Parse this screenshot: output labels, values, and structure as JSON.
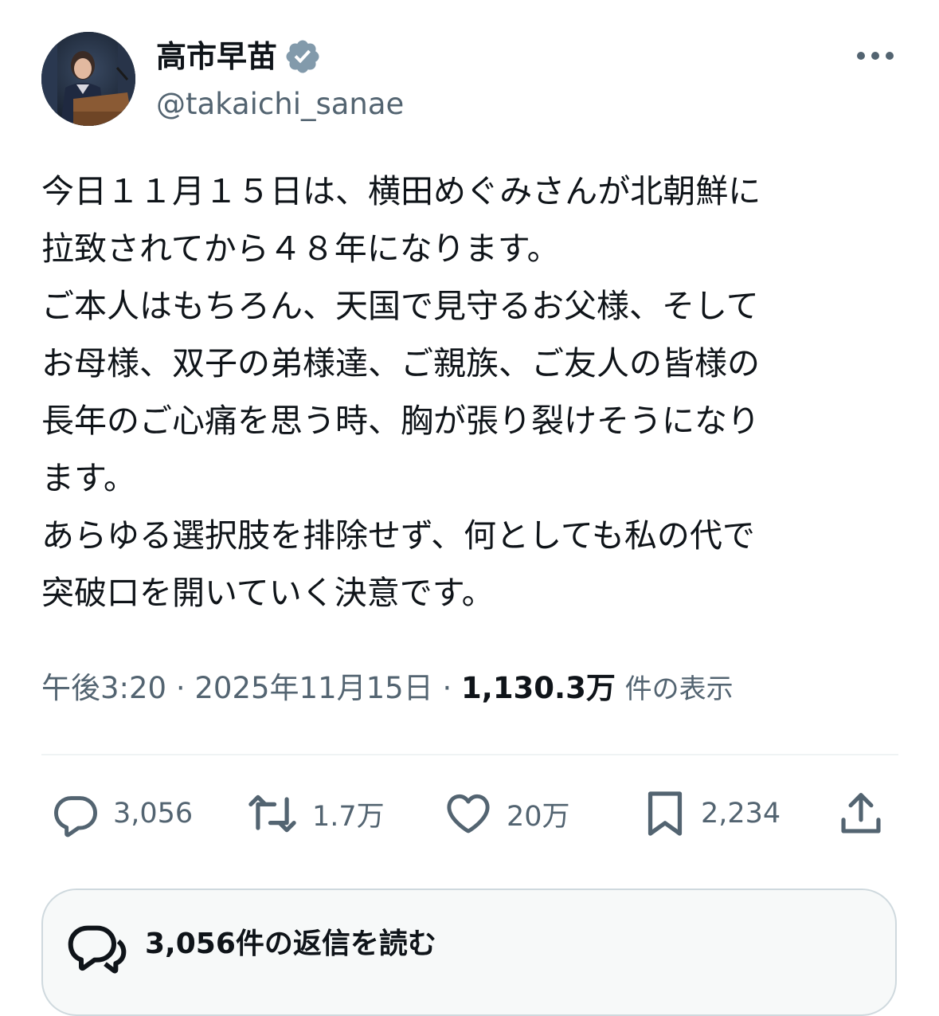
{
  "author": {
    "display_name": "高市早苗",
    "handle": "@takaichi_sanae",
    "verified_icon": "verified-badge-icon",
    "avatar_icon": "profile-photo"
  },
  "tweet": {
    "lines": [
      "今日１１月１５日は、横田めぐみさんが北朝鮮に",
      "拉致されてから４８年になります。",
      "ご本人はもちろん、天国で見守るお父様、そして",
      "お母様、双子の弟様達、ご親族、ご友人の皆様の",
      "長年のご心痛を思う時、胸が張り裂けそうになり",
      "ます。",
      "あらゆる選択肢を排除せず、何としても私の代で",
      "突破口を開いていく決意です。"
    ]
  },
  "meta": {
    "time": "午後3:20",
    "separator": "·",
    "date": "2025年11月15日",
    "views": "1,130.3万",
    "views_label": "件の表示"
  },
  "actions": {
    "reply_count": "3,056",
    "retweet_count": "1.7万",
    "like_count": "20万",
    "bookmark_count": "2,234"
  },
  "replies_button": {
    "label": "3,056件の返信を読む"
  },
  "colors": {
    "text": "#0f1419",
    "secondary": "#536471",
    "verified": "#829aab",
    "divider": "#eff3f4",
    "box_bg": "#f7f9f9"
  }
}
